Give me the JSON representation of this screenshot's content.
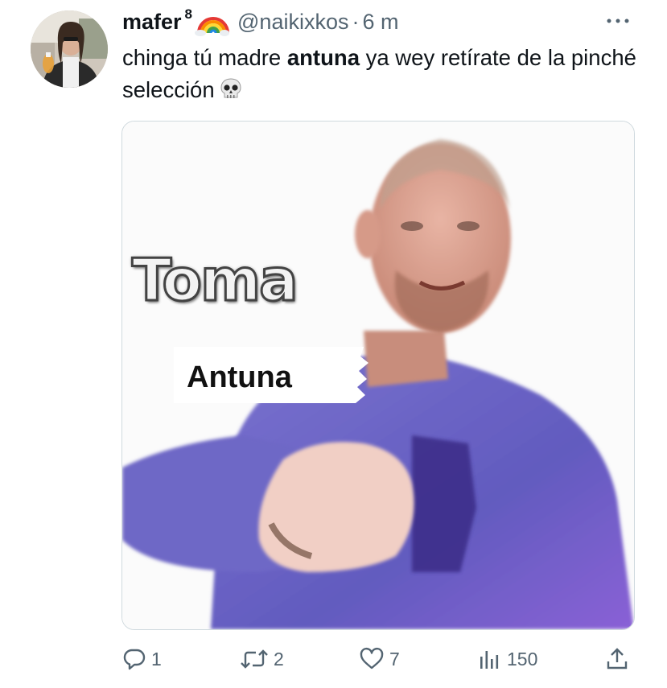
{
  "tweet": {
    "display_name": "mafer",
    "name_suffix": "8",
    "handle": "@naikixkos",
    "separator": "·",
    "time": "6 m",
    "text_before": "chinga tú madre ",
    "text_bold": "antuna",
    "text_after": " ya wey retírate de la pinché selección",
    "emoji": "skull-emoji",
    "name_emoji": "rainbow-emoji"
  },
  "media": {
    "caption_top": "Toma",
    "caption_label": "Antuna"
  },
  "actions": {
    "reply_count": "1",
    "retweet_count": "2",
    "like_count": "7",
    "views_count": "150"
  },
  "colors": {
    "text": "#0f1419",
    "secondary": "#536471",
    "border": "#cfd9de",
    "shirt": "#6e66c4"
  }
}
